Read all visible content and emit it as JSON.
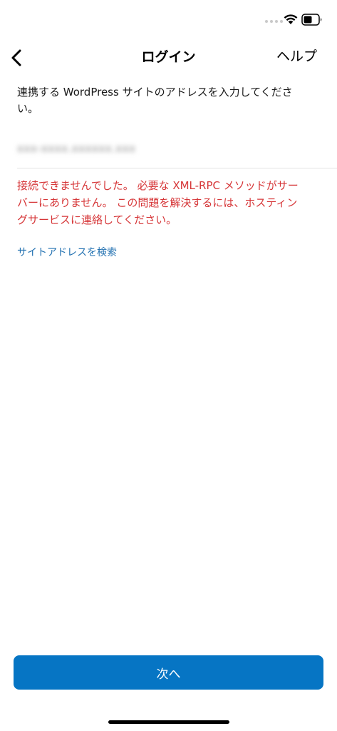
{
  "status_bar": {
    "wifi_icon": "wifi-icon",
    "battery_icon": "battery-icon"
  },
  "nav": {
    "back_icon": "chevron-left-icon",
    "title": "ログイン",
    "help_label": "ヘルプ"
  },
  "form": {
    "instructions": "連携する WordPress サイトのアドレスを入力してください。",
    "address_value": "xxx-xxxx.xxxxxx.xxx"
  },
  "error": {
    "message": "接続できませんでした。 必要な XML-RPC メソッドがサーバーにありません。 この問題を解決するには、ホスティングサービスに連絡してください。",
    "color": "#d63638"
  },
  "links": {
    "find_address": "サイトアドレスを検索",
    "color": "#2271b1"
  },
  "actions": {
    "next_label": "次へ",
    "accent_color": "#0675c4"
  }
}
